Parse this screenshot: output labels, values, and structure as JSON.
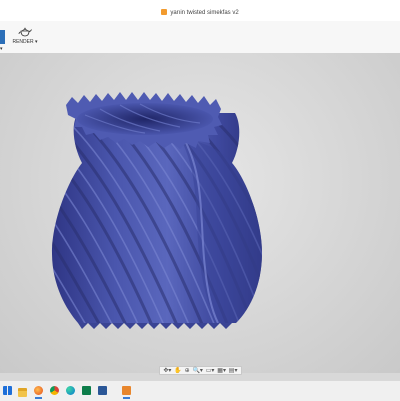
{
  "window": {
    "title": "yarıin twisted simekfas v2"
  },
  "toolbar": {
    "left_label": "▾",
    "render_label": "RENDER ▾"
  },
  "navbar": {
    "tools": [
      "✥▾",
      "✋",
      "⊕",
      "🔍▾",
      "▭▾",
      "▦▾",
      "▤▾"
    ]
  },
  "colors": {
    "vase": "#4752a3",
    "vase_highlight": "#6b78c8",
    "vase_shadow": "#2a3078",
    "background": "#d8d8d8"
  },
  "taskbar": {
    "apps": [
      "windows-icon",
      "file-explorer-icon",
      "chrome-icon",
      "edge-icon",
      "firefox-icon",
      "mail-icon",
      "fusion-360-icon",
      "word-icon",
      "settings-icon",
      "chrome-2-icon",
      "media-icon"
    ]
  }
}
